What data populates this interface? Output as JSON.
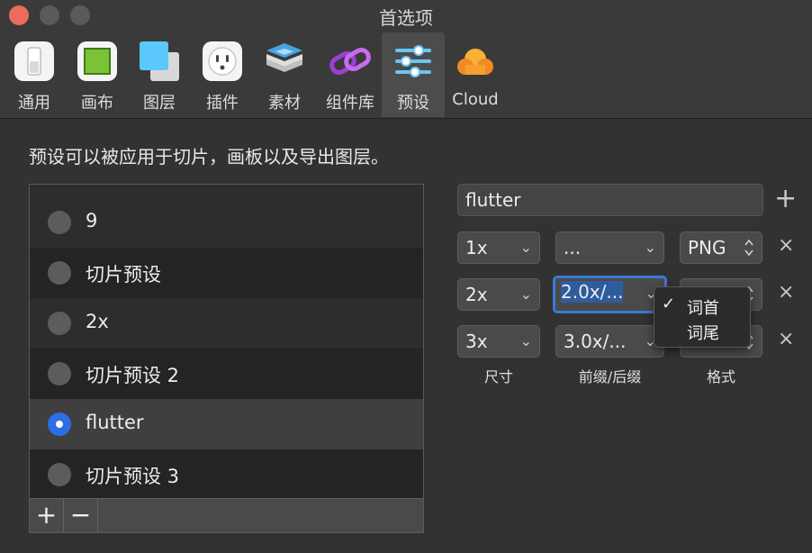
{
  "window": {
    "title": "首选项"
  },
  "toolbar": {
    "tabs": [
      {
        "label": "通用",
        "icon": "switch-icon"
      },
      {
        "label": "画布",
        "icon": "canvas-icon"
      },
      {
        "label": "图层",
        "icon": "layers-icon"
      },
      {
        "label": "插件",
        "icon": "plug-icon"
      },
      {
        "label": "素材",
        "icon": "assets-icon"
      },
      {
        "label": "组件库",
        "icon": "link-icon"
      },
      {
        "label": "预设",
        "icon": "sliders-icon",
        "active": true
      },
      {
        "label": "Cloud",
        "icon": "cloud-icon"
      }
    ]
  },
  "description": "预设可以被应用于切片，画板以及导出图层。",
  "presets": {
    "items": [
      {
        "label": "9",
        "selected": false
      },
      {
        "label": "切片预设",
        "selected": false
      },
      {
        "label": "2x",
        "selected": false
      },
      {
        "label": "切片预设 2",
        "selected": false
      },
      {
        "label": "flutter",
        "selected": true
      },
      {
        "label": "切片预设 3",
        "selected": false
      }
    ],
    "add_label": "+",
    "remove_label": "−"
  },
  "editor": {
    "name": "flutter",
    "add_label": "+",
    "remove_label": "×",
    "rows": [
      {
        "size": "1x",
        "suffix": "...",
        "format": "PNG"
      },
      {
        "size": "2x",
        "suffix": "2.0x/...",
        "format": ""
      },
      {
        "size": "3x",
        "suffix": "3.0x/...",
        "format": ""
      }
    ],
    "columns": {
      "size": "尺寸",
      "suffix": "前缀/后缀",
      "format": "格式"
    }
  },
  "popup": {
    "items": [
      {
        "label": "词首",
        "checked": true,
        "check": "✓"
      },
      {
        "label": "词尾",
        "checked": false,
        "check": ""
      }
    ]
  },
  "colors": {
    "accent": "#2d6ee6",
    "close": "#ed6a5e"
  }
}
